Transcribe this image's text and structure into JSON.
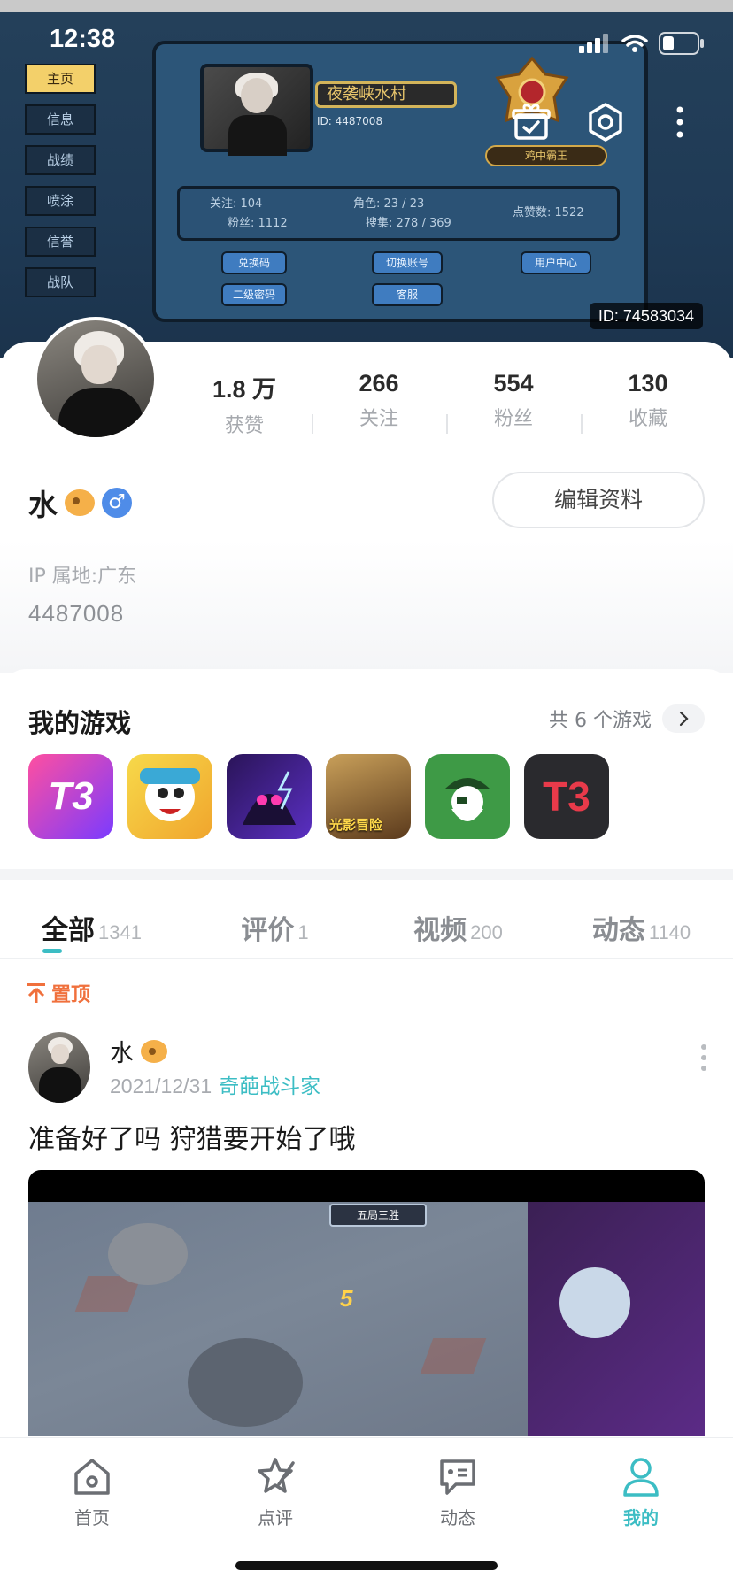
{
  "status_bar": {
    "time": "12:38"
  },
  "banner": {
    "menu": [
      "主页",
      "信息",
      "战绩",
      "喷涂",
      "信誉",
      "战队"
    ],
    "tab_title": "信息",
    "game_name": "夜袭峡水村",
    "game_id": "ID: 4487008",
    "stats": {
      "follow": "关注: 104",
      "fans": "粉丝: 1112",
      "roles": "角色: 23 / 23",
      "collect": "搜集: 278 / 369",
      "likes": "点赞数: 1522"
    },
    "buttons": [
      "兑换码",
      "切换账号",
      "用户中心",
      "二级密码",
      "客服"
    ],
    "rank": "鸡中霸王",
    "id_tag": "ID: 74583034"
  },
  "header_icons": [
    "gift-icon",
    "settings-icon",
    "more-icon"
  ],
  "profile": {
    "stats": [
      {
        "value": "1.8 万",
        "label": "获赞"
      },
      {
        "value": "266",
        "label": "关注"
      },
      {
        "value": "554",
        "label": "粉丝"
      },
      {
        "value": "130",
        "label": "收藏"
      }
    ],
    "name": "水",
    "gender_symbol": "♂",
    "edit_label": "编辑资料",
    "ip": "IP 属地:广东",
    "uid": "4487008"
  },
  "games": {
    "title": "我的游戏",
    "count_label": "共 6 个游戏",
    "icons": [
      {
        "name": "t3-game-icon",
        "text": "T3"
      },
      {
        "name": "cartoon-hero-game-icon",
        "text": ""
      },
      {
        "name": "neon-assassin-game-icon",
        "text": ""
      },
      {
        "name": "pubg-game-icon",
        "text": "光影冒险"
      },
      {
        "name": "pirate-game-icon",
        "text": ""
      },
      {
        "name": "t3-red-game-icon",
        "text": "T3"
      }
    ]
  },
  "tabs": [
    {
      "label": "全部",
      "count": "1341",
      "active": true
    },
    {
      "label": "评价",
      "count": "1",
      "active": false
    },
    {
      "label": "视频",
      "count": "200",
      "active": false
    },
    {
      "label": "动态",
      "count": "1140",
      "active": false
    }
  ],
  "post": {
    "pinned_label": "置顶",
    "author": "水",
    "date": "2021/12/31",
    "game": "奇葩战斗家",
    "text": "准备好了吗 狩猎要开始了哦",
    "video_hud": "五局三胜",
    "video_score": "5"
  },
  "bottom_nav": [
    {
      "label": "首页",
      "icon": "home-icon",
      "active": false
    },
    {
      "label": "点评",
      "icon": "review-pen-icon",
      "active": false
    },
    {
      "label": "动态",
      "icon": "feed-chat-icon",
      "active": false
    },
    {
      "label": "我的",
      "icon": "profile-icon",
      "active": true
    }
  ],
  "colors": {
    "accent": "#3cbdc4",
    "pinned": "#f0703c"
  }
}
